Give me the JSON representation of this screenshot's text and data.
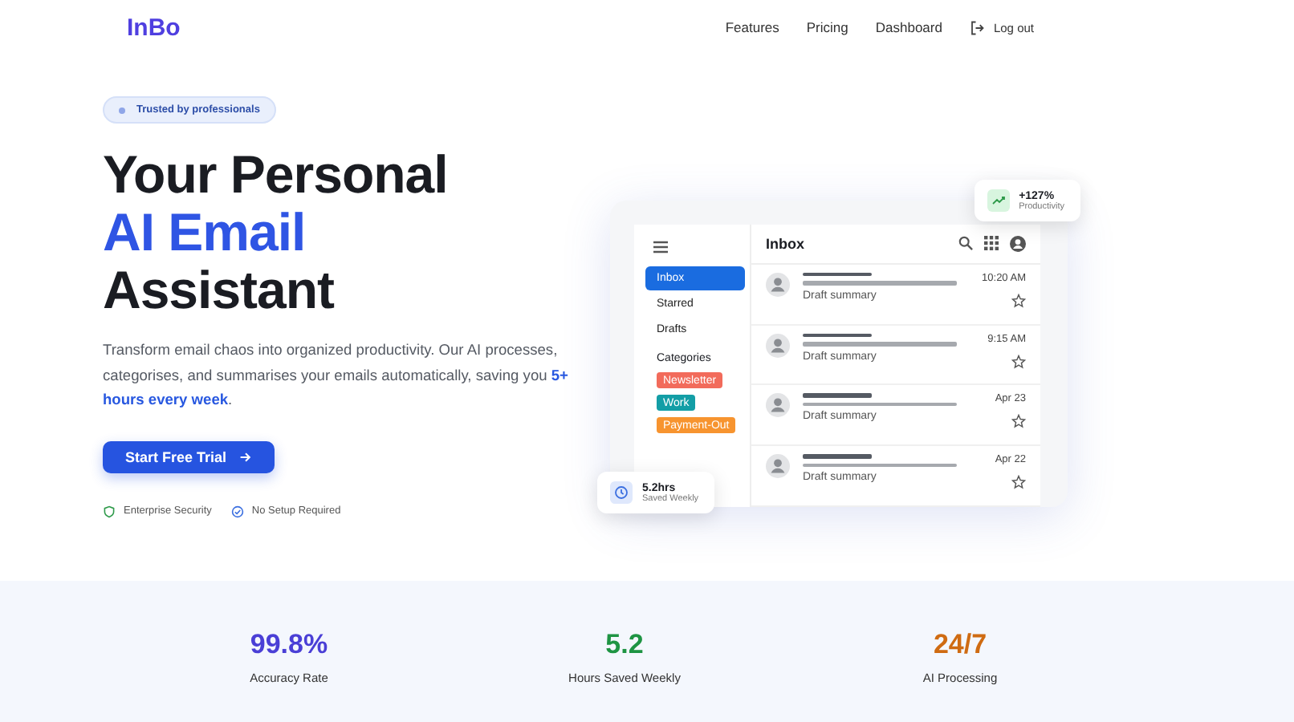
{
  "nav": {
    "logo": "InBo",
    "links": [
      "Features",
      "Pricing",
      "Dashboard"
    ],
    "logout": "Log out"
  },
  "hero": {
    "badge": "Trusted by professionals",
    "title_lines": [
      {
        "text": "Your Personal",
        "accent": false
      },
      {
        "text": "AI Email",
        "accent": true
      },
      {
        "text": "Assistant",
        "accent": false
      }
    ],
    "lead": "Transform email chaos into organized productivity. Our AI processes, categorises, and summarises your emails automatically, saving you **5+ hours every week**.",
    "cta": "Start Free Trial",
    "features": [
      {
        "kind": "shield",
        "label": "Enterprise Security"
      },
      {
        "kind": "check",
        "label": "No Setup Required"
      }
    ]
  },
  "mockup": {
    "title": "Inbox",
    "folders": [
      {
        "label": "Inbox",
        "selected": true
      },
      {
        "label": "Starred",
        "selected": false
      },
      {
        "label": "Drafts",
        "selected": false
      }
    ],
    "categories_label": "Categories",
    "categories": [
      {
        "label": "Newsletter",
        "color": "#f26b5b"
      },
      {
        "label": "Work",
        "color": "#139ea6"
      },
      {
        "label": "Payment-Out",
        "color": "#f7942f"
      }
    ],
    "emails": [
      {
        "time": "10:20 AM",
        "summary": "Draft summary",
        "starred": false
      },
      {
        "time": "9:15 AM",
        "summary": "Draft summary",
        "starred": false
      },
      {
        "time": "Apr 23",
        "summary": "Draft summary",
        "starred": false
      },
      {
        "time": "Apr 22",
        "summary": "Draft summary",
        "starred": false
      }
    ],
    "productivity": {
      "value": "+127%",
      "label": "Productivity"
    },
    "saved": {
      "value": "5.2hrs",
      "label": "Saved Weekly"
    }
  },
  "stats": [
    {
      "value": "99.8%",
      "label": "Accuracy Rate",
      "color": "#4a3fd6"
    },
    {
      "value": "5.2",
      "label": "Hours Saved Weekly",
      "color": "#1e9443"
    },
    {
      "value": "24/7",
      "label": "AI Processing",
      "color": "#cf6b12"
    }
  ]
}
